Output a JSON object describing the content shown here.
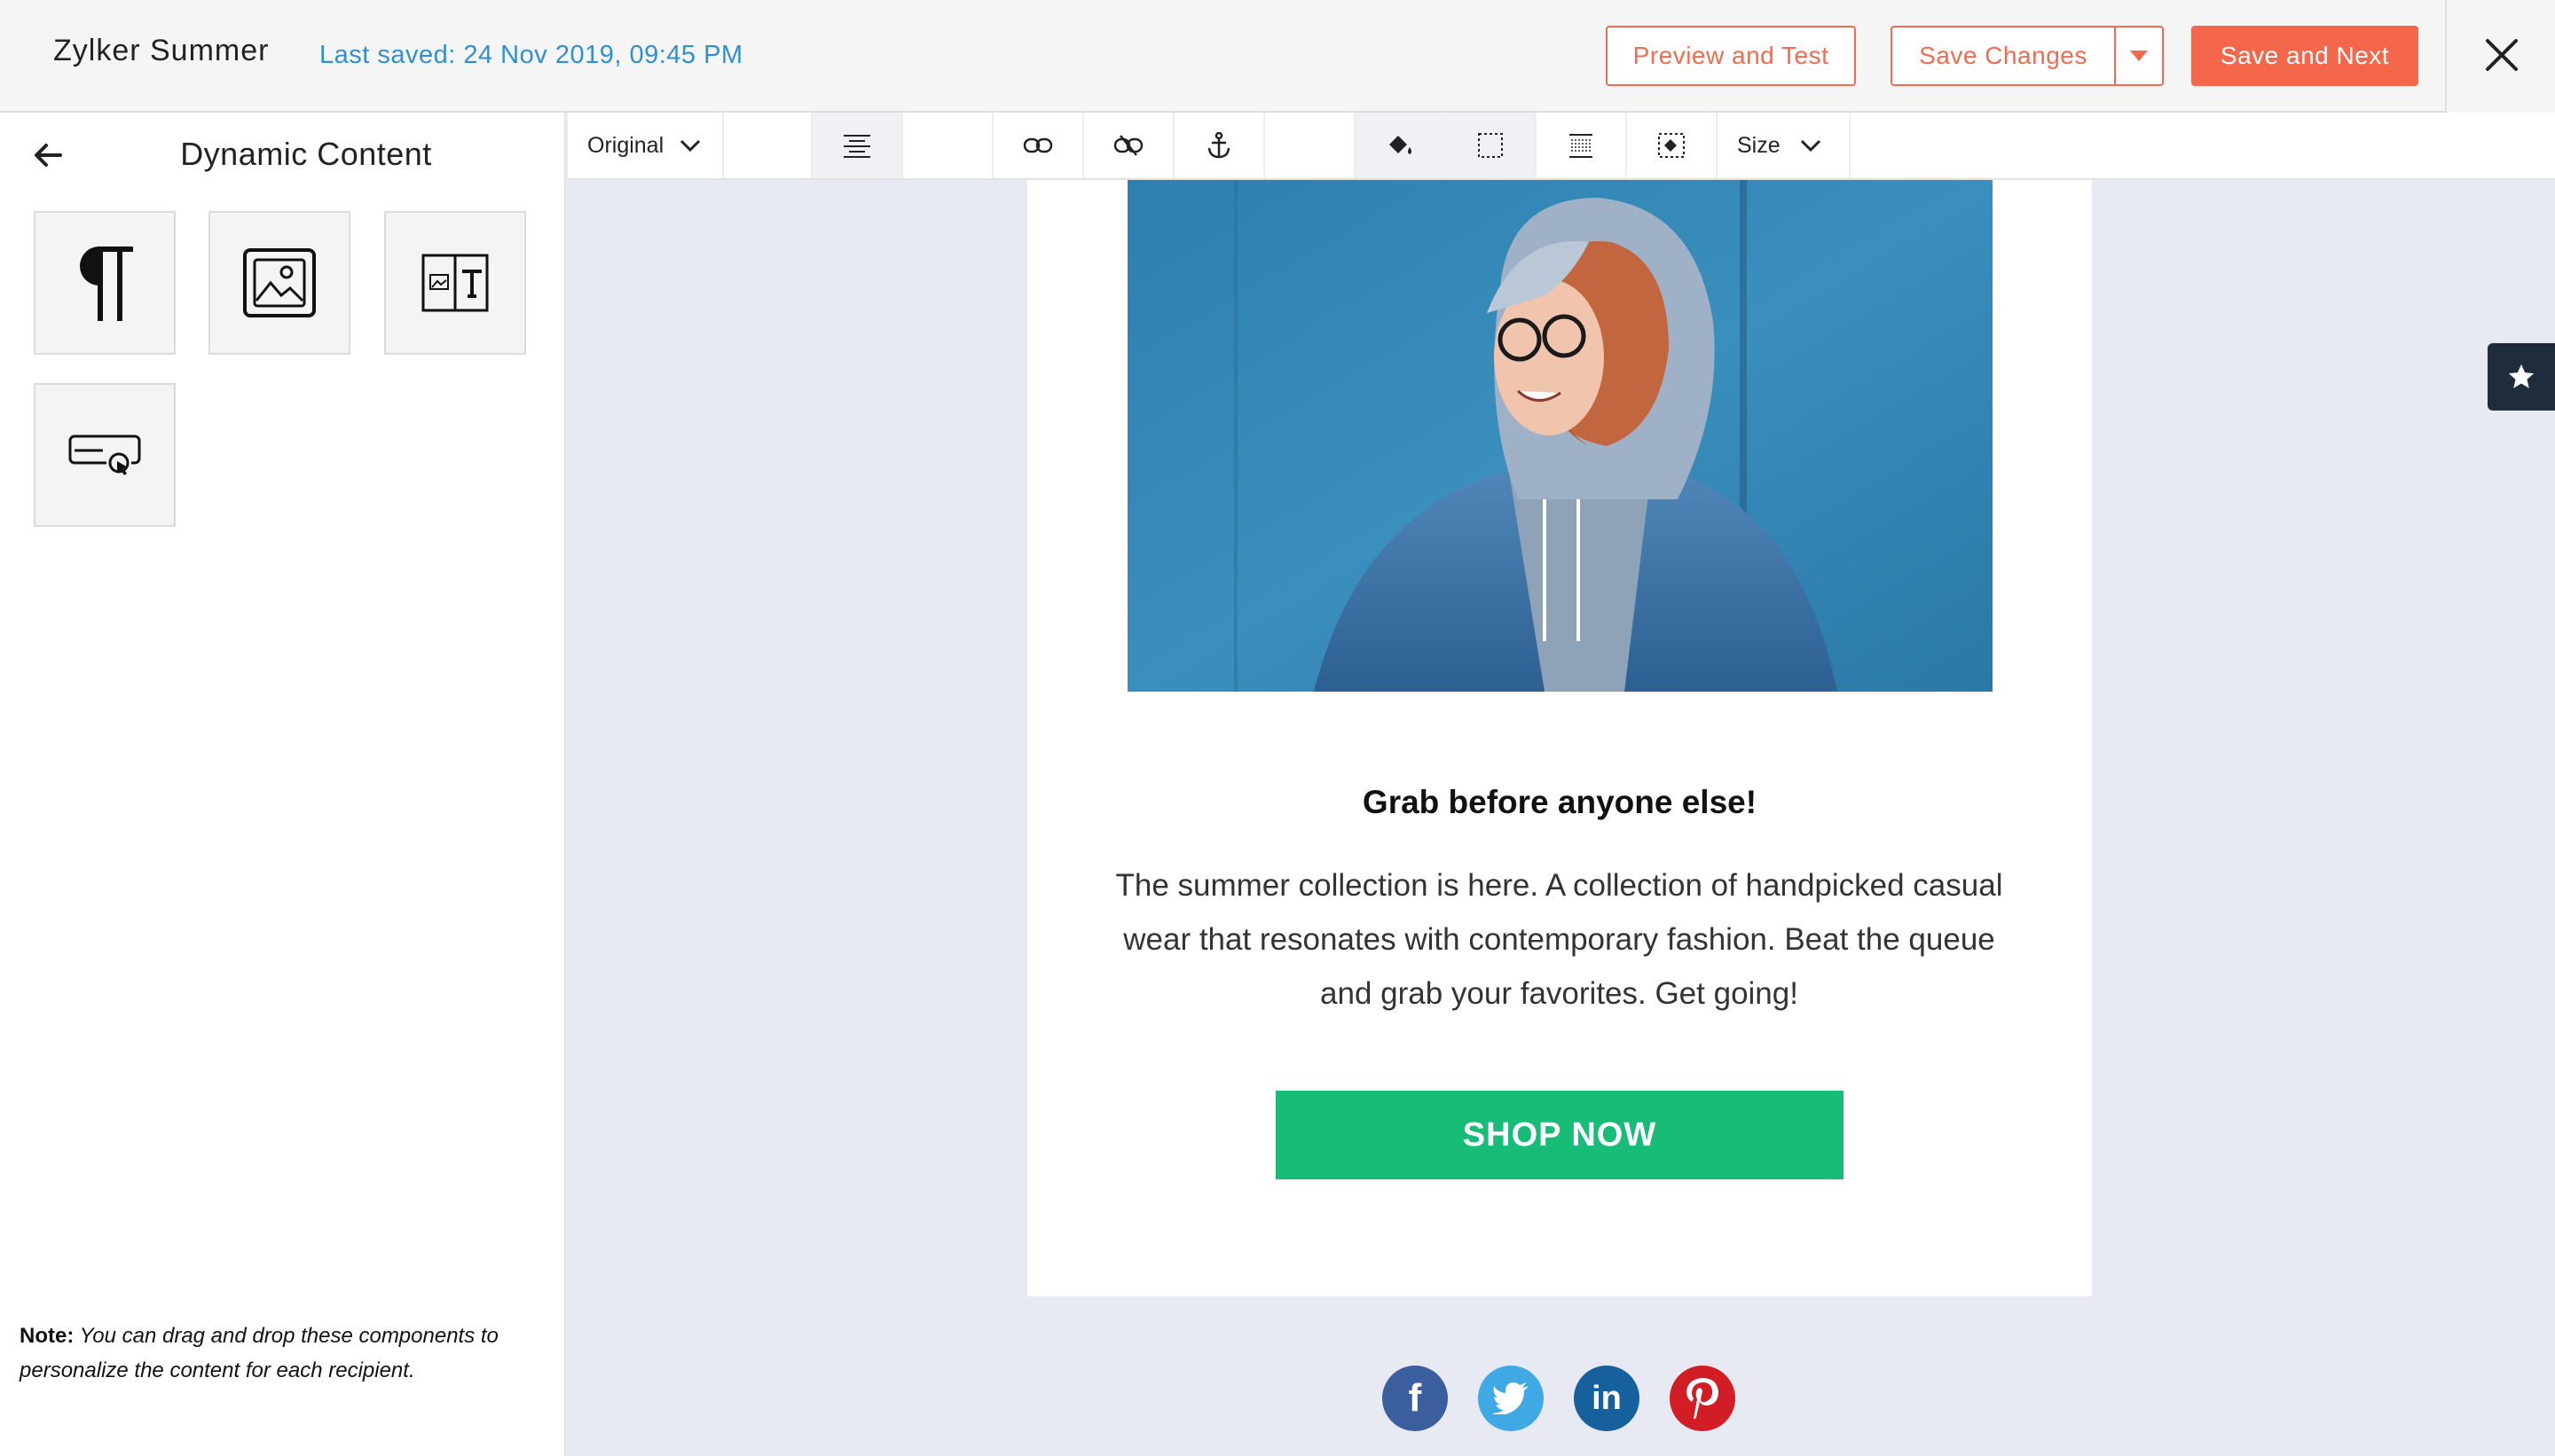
{
  "header": {
    "title": "Zylker Summer",
    "last_saved": "Last saved: 24 Nov 2019, 09:45 PM",
    "preview_label": "Preview and Test",
    "save_changes_label": "Save Changes",
    "save_next_label": "Save and Next"
  },
  "panel": {
    "title": "Dynamic Content",
    "tiles": [
      "paragraph-icon",
      "image-icon",
      "image-text-icon",
      "button-icon"
    ],
    "note_label": "Note:",
    "note_text": "You can drag and drop these components to personalize the content for each recipient."
  },
  "toolbar": {
    "original_label": "Original",
    "size_label": "Size",
    "icons": [
      "align-center-icon",
      "link-icon",
      "unlink-icon",
      "anchor-icon",
      "fill-color-icon",
      "border-icon",
      "padding-icon",
      "select-element-icon"
    ]
  },
  "email": {
    "headline": "Grab before anyone else!",
    "body": "The summer collection is here. A collection of handpicked casual wear that resonates with contemporary fashion. Beat the queue and grab your favorites. Get going!",
    "cta_label": "SHOP NOW",
    "social": [
      "f",
      "in"
    ]
  },
  "colors": {
    "accent": "#f4674a",
    "link_blue": "#2f8fd6",
    "cta_green": "#17bd76",
    "canvas_bg": "#e7eaf3"
  }
}
